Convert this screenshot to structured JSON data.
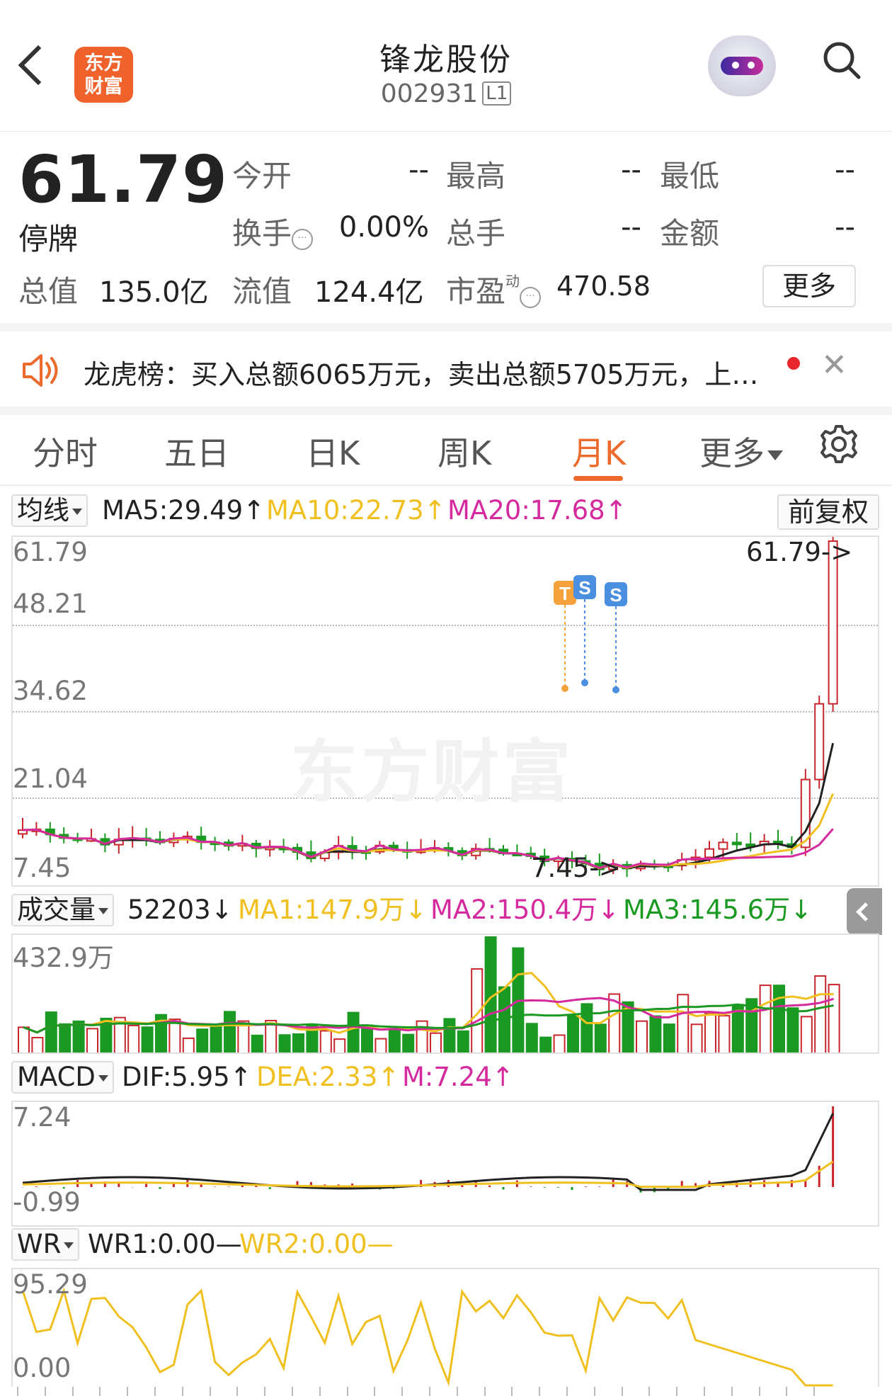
{
  "header": {
    "logo_text": "东方财富",
    "stock_name": "锋龙股份",
    "stock_code": "002931",
    "level_badge": "L1"
  },
  "quote": {
    "price": "61.79",
    "status": "停牌",
    "fields": [
      {
        "label": "今开",
        "value": "--"
      },
      {
        "label": "最高",
        "value": "--"
      },
      {
        "label": "最低",
        "value": "--"
      },
      {
        "label": "换手",
        "value": "0.00%"
      },
      {
        "label": "总手",
        "value": "--"
      },
      {
        "label": "金额",
        "value": "--"
      }
    ],
    "total_cap_label": "总值",
    "total_cap": "135.0亿",
    "float_cap_label": "流值",
    "float_cap": "124.4亿",
    "pe_label": "市盈",
    "pe_sup": "动",
    "pe_value": "470.58",
    "more_button": "更多",
    "info_icon": "···"
  },
  "notice": {
    "text": "龙虎榜：买入总额6065万元，卖出总额5705万元，上…",
    "close": "✕"
  },
  "tabs": {
    "items": [
      "分时",
      "五日",
      "日K",
      "周K",
      "月K",
      "更多"
    ],
    "active": "月K"
  },
  "ma_row": {
    "selector": "均线",
    "ma5": "MA5:29.49↑",
    "ma10": "MA10:22.73↑",
    "ma20": "MA20:17.68↑",
    "adjust": "前复权"
  },
  "kline": {
    "y_labels": [
      "61.79",
      "48.21",
      "34.62",
      "21.04",
      "7.45"
    ],
    "max_marker": "61.79->",
    "min_marker": "7.45->",
    "watermark": "东方财富",
    "badges": [
      "T",
      "S",
      "S"
    ]
  },
  "volume_row": {
    "selector": "成交量",
    "value": "52203↓",
    "ma1": "MA1:147.9万↓",
    "ma2": "MA2:150.4万↓",
    "ma3": "MA3:145.6万↓",
    "y_label": "432.9万"
  },
  "macd_row": {
    "selector": "MACD",
    "dif": "DIF:5.95↑",
    "dea": "DEA:2.33↑",
    "m": "M:7.24↑",
    "y_top": "7.24",
    "y_bottom": "-0.99"
  },
  "wr_row": {
    "selector": "WR",
    "wr1": "WR1:0.00—",
    "wr2": "WR2:0.00—",
    "y_top": "95.29",
    "y_bottom": "0.00"
  },
  "colors": {
    "up": "#c8262c",
    "down": "#1a9a22",
    "ma5": "#222222",
    "ma10": "#f0c020",
    "ma20": "#d52a9e",
    "accent": "#ec6a2b",
    "logo": "#f0622c"
  }
}
